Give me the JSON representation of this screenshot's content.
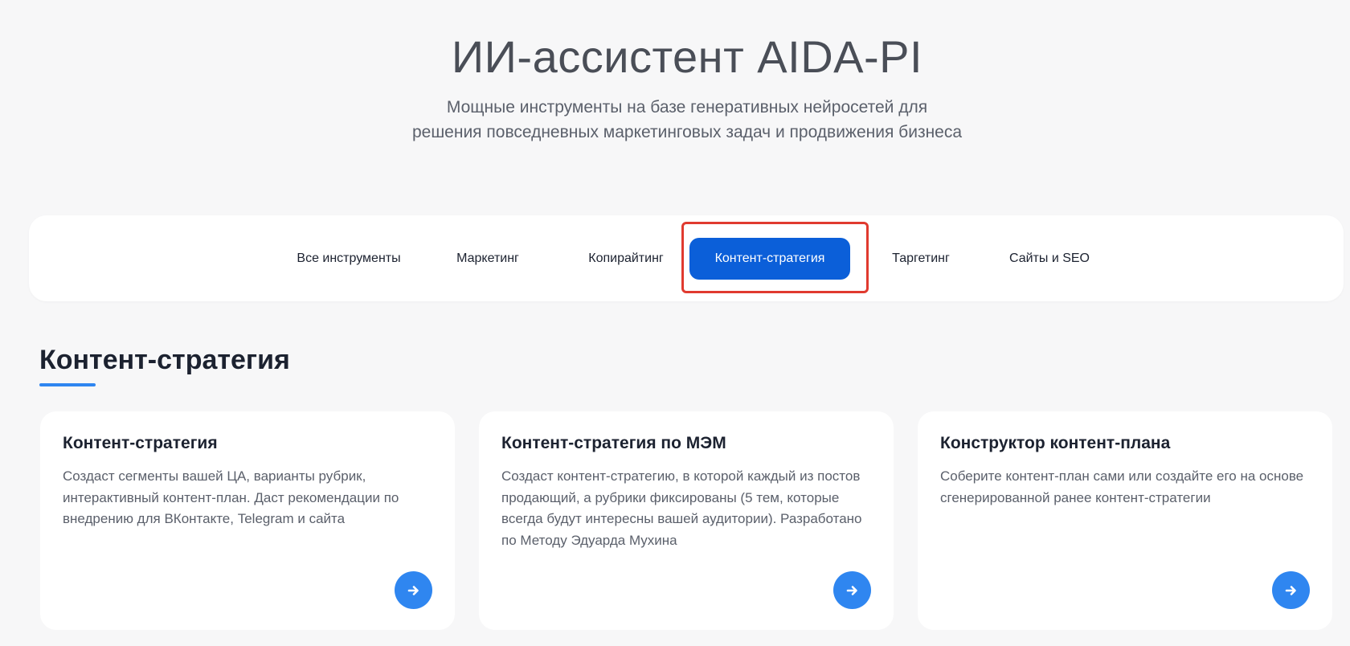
{
  "hero": {
    "title": "ИИ-ассистент AIDA-PI",
    "subtitle_line1": "Мощные инструменты на базе генеративных нейросетей для",
    "subtitle_line2": "решения повседневных маркетинговых задач и продвижения бизнеса"
  },
  "tabs": [
    {
      "label": "Все инструменты",
      "active": false
    },
    {
      "label": "Маркетинг",
      "active": false
    },
    {
      "label": "Копирайтинг",
      "active": false
    },
    {
      "label": "Контент-стратегия",
      "active": true
    },
    {
      "label": "Таргетинг",
      "active": false
    },
    {
      "label": "Сайты и SEO",
      "active": false
    }
  ],
  "section": {
    "title": "Контент-стратегия"
  },
  "cards": [
    {
      "title": "Контент-стратегия",
      "description": "Создаст сегменты вашей ЦА, варианты рубрик, интерактивный контент-план. Даст рекомендации по внедрению для ВКонтакте, Telegram и сайта",
      "action_icon": "arrow-right-icon"
    },
    {
      "title": "Контент-стратегия по МЭМ",
      "description": "Создаст контент-стратегию, в которой каждый из постов продающий, а рубрики фиксированы (5 тем, которые всегда будут интересны вашей аудитории). Разработано по Методу Эдуарда Мухина",
      "action_icon": "arrow-right-icon"
    },
    {
      "title": "Конструктор контент-плана",
      "description": "Соберите контент-план сами или создайте его на основе сгенерированной ранее контент-стратегии",
      "action_icon": "arrow-right-icon"
    }
  ],
  "colors": {
    "accent": "#0b5fd9",
    "arrow_button": "#2f86f0",
    "highlight": "#e03a2f",
    "background": "#f7f7f8"
  }
}
